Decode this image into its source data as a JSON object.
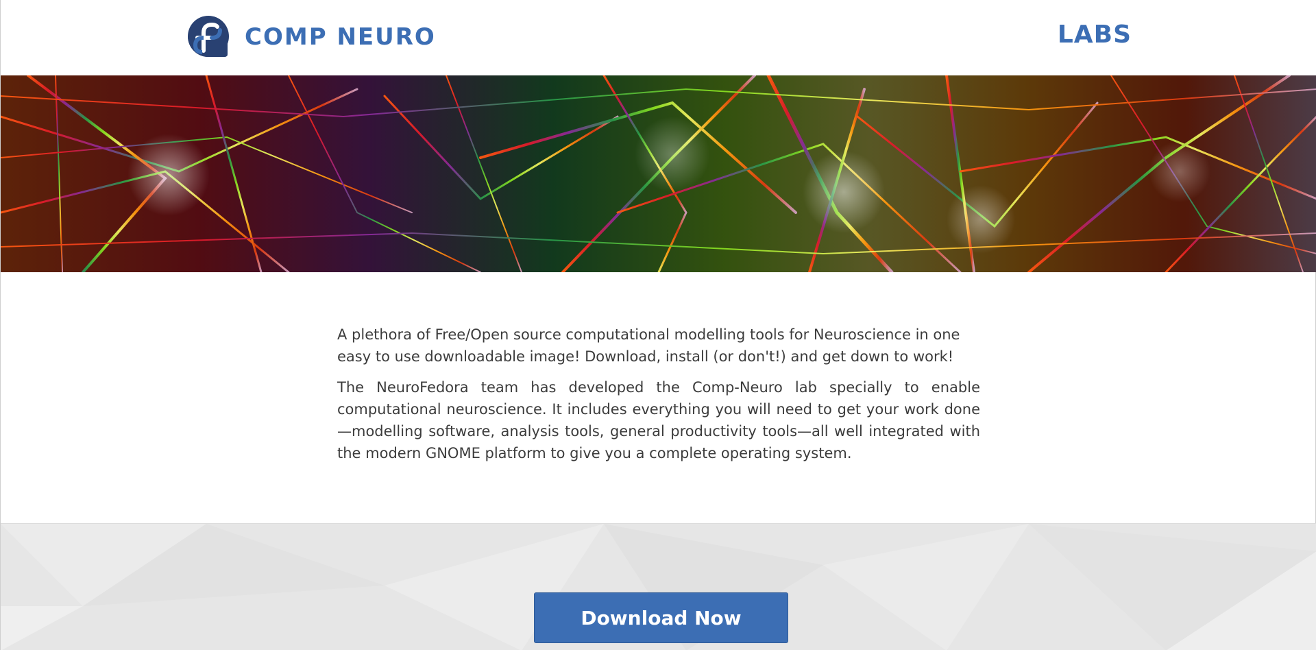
{
  "header": {
    "brand_name": "COMP NEURO",
    "nav_right": "LABS",
    "logo_icon": "fedora-logo-icon"
  },
  "banner": {
    "image": "neurons-banner"
  },
  "content": {
    "paragraphs": [
      "A plethora of Free/Open source computational modelling tools for Neuroscience in one easy to use downloadable image! Download, install (or don't!) and get down to work!",
      "The NeuroFedora team has developed the Comp-Neuro lab specially to enable computational neuroscience. It includes everything you will need to get your work done—modelling software, analysis tools, general productivity tools—all well integrated with the modern GNOME platform to give you a complete operating system."
    ]
  },
  "download": {
    "button_label": "Download Now"
  },
  "colors": {
    "brand_blue": "#3c6eb4",
    "text": "#3c3c3c",
    "download_bg": "#e6e6e6"
  }
}
